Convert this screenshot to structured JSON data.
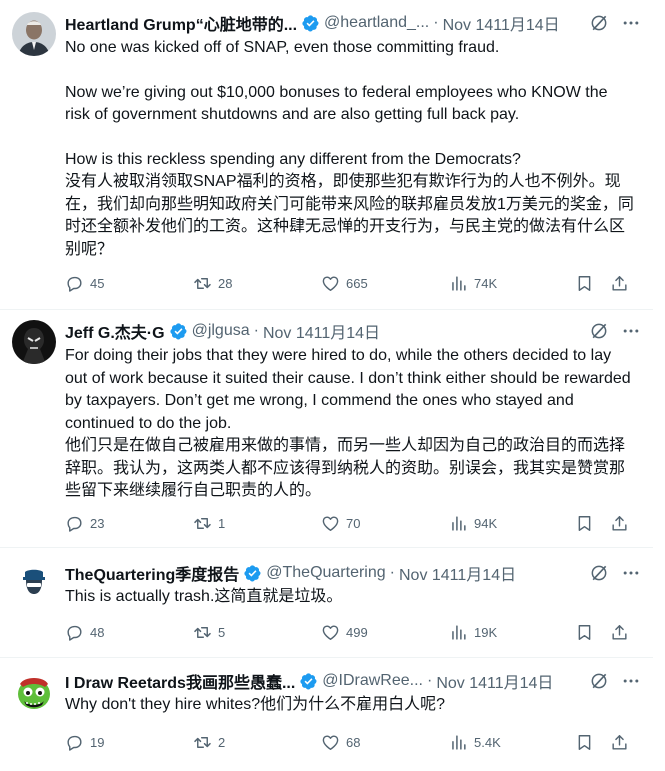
{
  "posts": [
    {
      "name": "Heartland Grump“心脏地带的...",
      "handle": "@heartland_...",
      "dot": "·",
      "date": "Nov 1411月14日",
      "paragraphs": [
        "No one was kicked off of SNAP, even those committing fraud.",
        "Now we’re giving out $10,000 bonuses to federal employees who KNOW the risk of government shutdowns and are also getting full back pay.",
        "How is this reckless spending any different from the Democrats?\n没有人被取消领取SNAP福利的资格，即使那些犯有欺诈行为的人也不例外。现在，我们却向那些明知政府关门可能带来风险的联邦雇员发放1万美元的奖金，同时还全额补发他们的工资。这种肆无忌惮的开支行为，与民主党的做法有什么区别呢？"
      ],
      "replies": "45",
      "reposts": "28",
      "likes": "665",
      "views": "74K"
    },
    {
      "name": "Jeff G.杰夫·G",
      "handle": "@jlgusa",
      "dot": "·",
      "date": "Nov 1411月14日",
      "paragraphs": [
        "For doing their jobs that they were hired to do, while the others decided to lay out of work because it suited their cause. I don’t think either should be rewarded by taxpayers. Don’t get me wrong, I commend the ones who stayed and continued to do the job.\n他们只是在做自己被雇用来做的事情，而另一些人却因为自己的政治目的而选择辞职。我认为，这两类人都不应该得到纳税人的资助。别误会，我其实是赞赏那些留下来继续履行自己职责的人的。"
      ],
      "replies": "23",
      "reposts": "1",
      "likes": "70",
      "views": "94K"
    },
    {
      "name": "TheQuartering季度报告",
      "handle": "@TheQuartering",
      "dot": "·",
      "date": "Nov 1411月14日",
      "paragraphs": [
        "This is actually trash.这简直就是垃圾。"
      ],
      "replies": "48",
      "reposts": "5",
      "likes": "499",
      "views": "19K"
    },
    {
      "name": "I Draw Reetards我画那些愚蠢...",
      "handle": "@IDrawRee...",
      "dot": "·",
      "date": "Nov 1411月14日",
      "paragraphs": [
        "Why don't they hire whites?他们为什么不雇用白人呢?"
      ],
      "replies": "19",
      "reposts": "2",
      "likes": "68",
      "views": "5.4K"
    }
  ],
  "colors": {
    "verified": "#1d9bf0",
    "muted": "#536471",
    "text": "#0f1419",
    "divider": "#eff3f4"
  },
  "icons": [
    "verified-badge-icon",
    "grok-icon",
    "more-icon",
    "reply-icon",
    "repost-icon",
    "like-icon",
    "views-icon",
    "bookmark-icon",
    "share-icon"
  ]
}
